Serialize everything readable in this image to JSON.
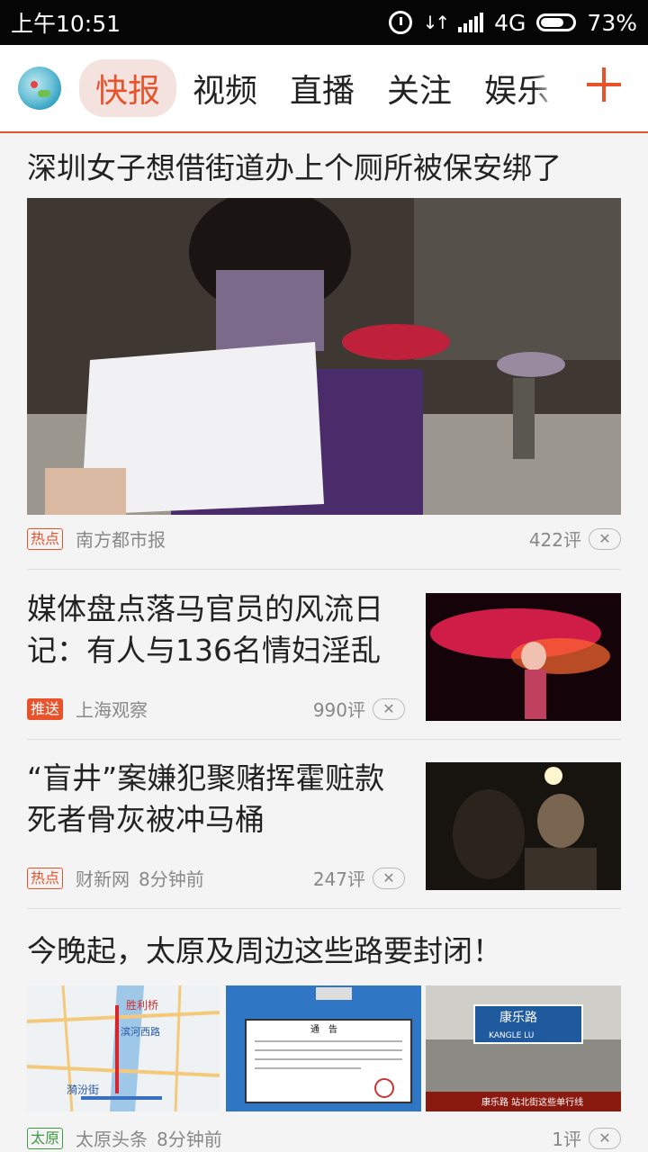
{
  "status_bar": {
    "time": "上午10:51",
    "network": "4G",
    "battery": "73%"
  },
  "nav": {
    "tabs": [
      "快报",
      "视频",
      "直播",
      "关注",
      "娱乐"
    ],
    "active_index": 0,
    "add_icon": "plus-icon",
    "accent_color": "#e8532c"
  },
  "feed": [
    {
      "title": "深圳女子想借街道办上个厕所被保安绑了",
      "tag": "热点",
      "source": "南方都市报",
      "time": "",
      "comments": "422评",
      "layout": "large-image"
    },
    {
      "title": "媒体盘点落马官员的风流日记：有人与136名情妇淫乱",
      "tag": "推送",
      "source": "上海观察",
      "time": "",
      "comments": "990评",
      "layout": "right-thumb"
    },
    {
      "title": "“盲井”案嫌犯聚赌挥霍赃款死者骨灰被冲马桶",
      "tag": "热点",
      "source": "财新网",
      "time": "8分钟前",
      "comments": "247评",
      "layout": "right-thumb"
    },
    {
      "title": "今晚起，太原及周边这些路要封闭！",
      "tag": "太原",
      "source": "太原头条",
      "time": "8分钟前",
      "comments": "1评",
      "layout": "three-images",
      "image_texts": {
        "map": [
          "胜利桥",
          "滨河西路",
          "漪汾街"
        ],
        "notice": [
          "通　告",
          "经晋中市政府决定，2016年6月10日至2016年10月15日迎宾路封闭施工…",
          "晋中市公安局"
        ],
        "street": [
          "康乐路",
          "KANGLE LU",
          "康乐路 站北街这些单行线"
        ]
      }
    }
  ]
}
